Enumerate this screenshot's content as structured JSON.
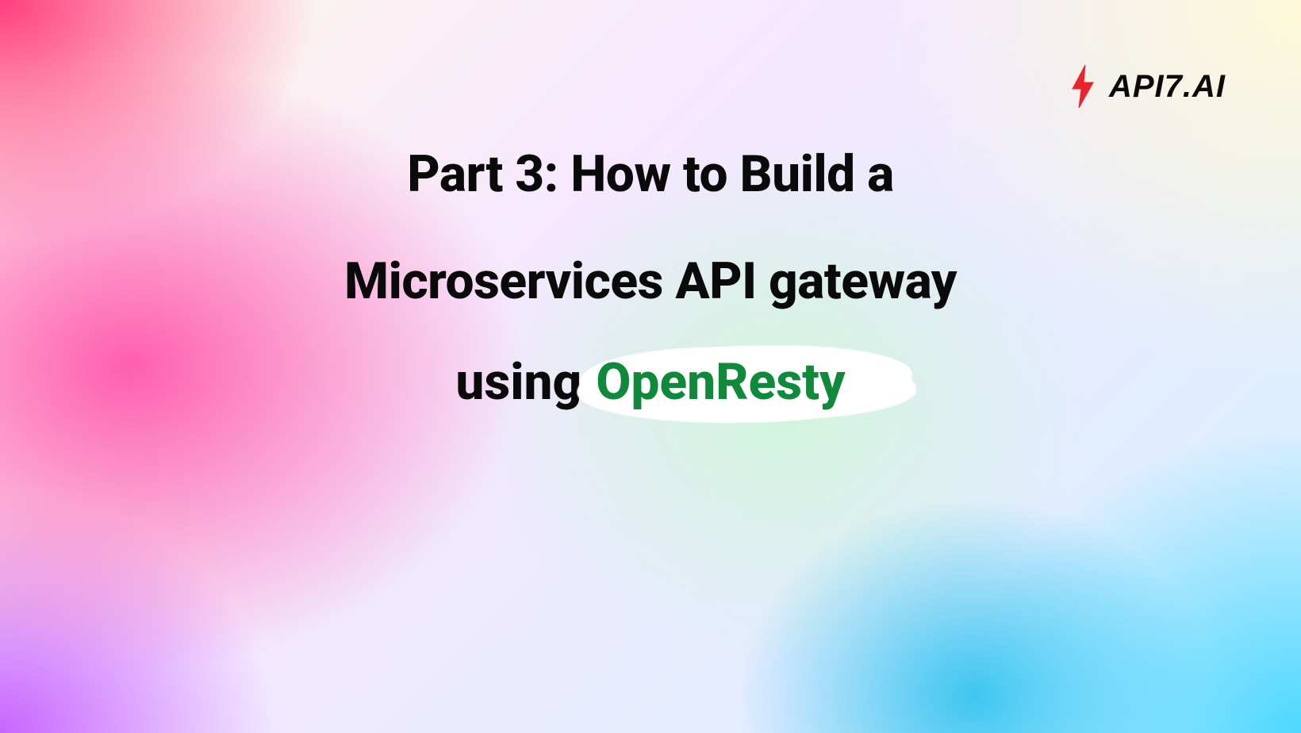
{
  "logo": {
    "text": "API7.AI",
    "mark_color": "#e8232a"
  },
  "title": {
    "line1": "Part 3: How to Build a",
    "line2": "Microservices API gateway",
    "line3_prefix": "using",
    "line3_highlight": "OpenResty"
  },
  "colors": {
    "highlight_text": "#0e8a3a",
    "title_text": "#0a0a0a",
    "highlight_bg": "#ffffff"
  }
}
